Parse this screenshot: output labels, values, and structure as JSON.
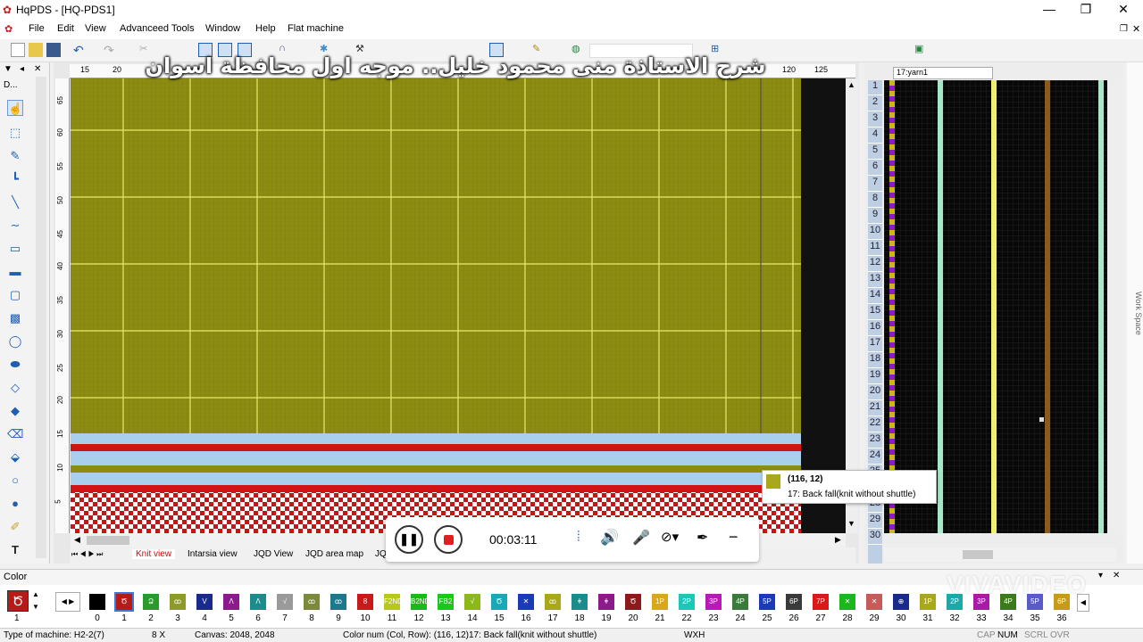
{
  "window": {
    "title": "HqPDS - [HQ-PDS1]",
    "minimize": "—",
    "maximize": "❐",
    "close": "✕"
  },
  "menu": [
    "File",
    "Edit",
    "View",
    "Advanceed Tools",
    "Window",
    "Help",
    "Flat machine"
  ],
  "panel": {
    "left_header": "D..."
  },
  "ruler_top": [
    "15",
    "20",
    "120",
    "125"
  ],
  "ruler_left": [
    "65",
    "60",
    "55",
    "50",
    "45",
    "40",
    "35",
    "30",
    "25",
    "20",
    "15",
    "10",
    "5"
  ],
  "view_tabs": [
    "Knit view",
    "Intarsia view",
    "JQD View",
    "JQD area map",
    "JQ"
  ],
  "right": {
    "yarn_select": "17:yarn1",
    "row_numbers": [
      "1",
      "2",
      "3",
      "4",
      "5",
      "6",
      "7",
      "8",
      "9",
      "10",
      "11",
      "12",
      "13",
      "14",
      "15",
      "16",
      "17",
      "18",
      "19",
      "20",
      "21",
      "22",
      "23",
      "24",
      "25",
      "",
      "28",
      "29",
      "30"
    ],
    "workspace_label": "Work Space"
  },
  "tooltip": {
    "coords": "(116, 12)",
    "text": "17: Back fall(knit without shuttle)"
  },
  "recorder": {
    "time": "00:03:11"
  },
  "caption": "شرح الاستاذة منى محمود خليل.. موجه اول محافظة اسوان",
  "watermark": "VIVAVIDEO",
  "color_panel": {
    "title": "Color",
    "current_index": "1",
    "swatches": [
      {
        "n": "0",
        "c": "#000000",
        "t": ""
      },
      {
        "n": "1",
        "c": "#b81a1a",
        "t": "Ծ"
      },
      {
        "n": "2",
        "c": "#2a9a2a",
        "t": "Ձ"
      },
      {
        "n": "3",
        "c": "#8c9a2a",
        "t": "ꝏ"
      },
      {
        "n": "4",
        "c": "#1a2a8c",
        "t": "V"
      },
      {
        "n": "5",
        "c": "#8c1a8c",
        "t": "Λ"
      },
      {
        "n": "6",
        "c": "#1a8c8c",
        "t": "Λ"
      },
      {
        "n": "7",
        "c": "#9a9a9a",
        "t": "√"
      },
      {
        "n": "8",
        "c": "#7a8a3a",
        "t": "ꝏ"
      },
      {
        "n": "9",
        "c": "#1a7a8c",
        "t": "ꝏ"
      },
      {
        "n": "10",
        "c": "#c81a1a",
        "t": "8"
      },
      {
        "n": "11",
        "c": "#b8c81a",
        "t": "F2ND"
      },
      {
        "n": "12",
        "c": "#1ab81a",
        "t": "B2ND"
      },
      {
        "n": "13",
        "c": "#1ac81a",
        "t": "FB2"
      },
      {
        "n": "14",
        "c": "#8cb81a",
        "t": "√"
      },
      {
        "n": "15",
        "c": "#1aa8b8",
        "t": "Ծ"
      },
      {
        "n": "16",
        "c": "#1a3ab8",
        "t": "✕"
      },
      {
        "n": "17",
        "c": "#a8a81a",
        "t": "ꝏ"
      },
      {
        "n": "18",
        "c": "#1a8c8c",
        "t": "ǂ"
      },
      {
        "n": "19",
        "c": "#8c1a8c",
        "t": "ǂ"
      },
      {
        "n": "20",
        "c": "#8c1a1a",
        "t": "Ծ"
      },
      {
        "n": "21",
        "c": "#d8a81a",
        "t": "1P"
      },
      {
        "n": "22",
        "c": "#1ac8b8",
        "t": "2P"
      },
      {
        "n": "23",
        "c": "#b81ab8",
        "t": "3P"
      },
      {
        "n": "24",
        "c": "#3a7a3a",
        "t": "4P"
      },
      {
        "n": "25",
        "c": "#1a3ab8",
        "t": "5P"
      },
      {
        "n": "26",
        "c": "#3a3a3a",
        "t": "6P"
      },
      {
        "n": "27",
        "c": "#d81a1a",
        "t": "7P"
      },
      {
        "n": "28",
        "c": "#1ab81a",
        "t": "✕"
      },
      {
        "n": "29",
        "c": "#c85a5a",
        "t": "✕"
      },
      {
        "n": "30",
        "c": "#1a2a8c",
        "t": "⊕"
      },
      {
        "n": "31",
        "c": "#a8a81a",
        "t": "1P"
      },
      {
        "n": "32",
        "c": "#1aa8a8",
        "t": "2P"
      },
      {
        "n": "33",
        "c": "#a81aa8",
        "t": "3P"
      },
      {
        "n": "34",
        "c": "#3a7a1a",
        "t": "4P"
      },
      {
        "n": "35",
        "c": "#5a5ac8",
        "t": "5P"
      },
      {
        "n": "36",
        "c": "#c89a1a",
        "t": "6P"
      }
    ]
  },
  "status": {
    "machine": "Type of machine: H2-2(7)",
    "zoom": "8 X",
    "canvas": "Canvas: 2048, 2048",
    "colornum": "Color num  (Col, Row): (116, 12)17: Back fall(knit without shuttle)",
    "wxh": "WXH",
    "cap": "CAP",
    "num": "NUM",
    "scrl": "SCRL",
    "ovr": "OVR"
  },
  "colors": {
    "knit_bg": "#8c8c12",
    "red_row": "#d01414",
    "light_blue_row": "#a8d0ec",
    "accent": "#1e5fb4"
  }
}
